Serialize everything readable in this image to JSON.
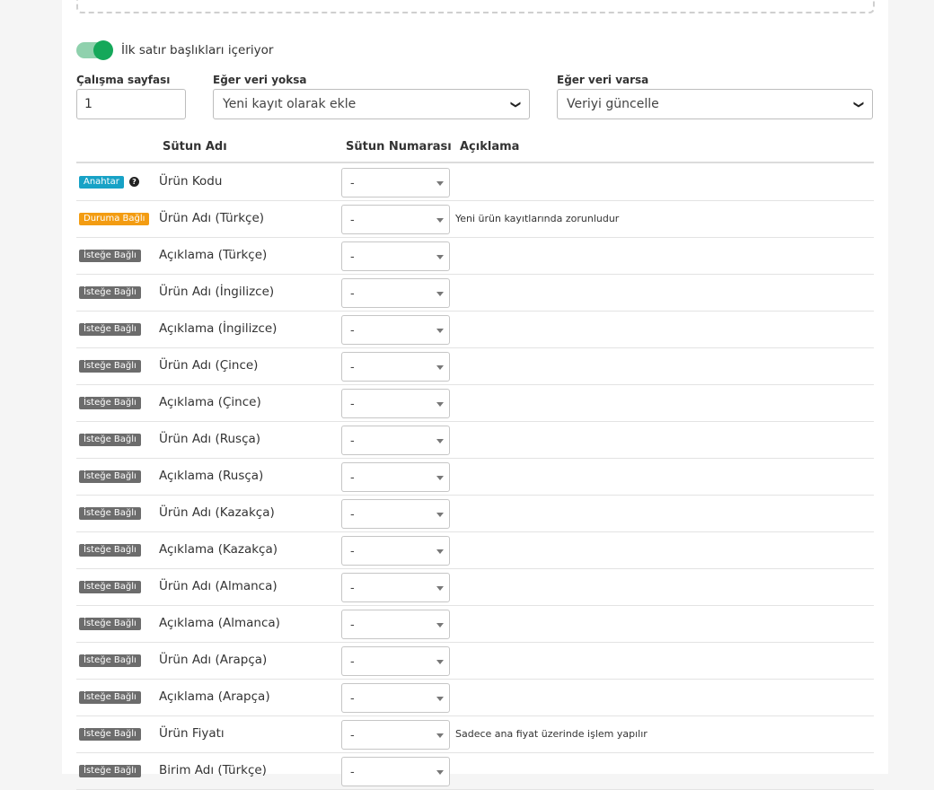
{
  "toggle": {
    "label": "İlk satır başlıkları içeriyor",
    "on": true
  },
  "fields": {
    "sheet_label": "Çalışma sayfası",
    "sheet_value": "1",
    "if_no_data_label": "Eğer veri yoksa",
    "if_no_data_value": "Yeni kayıt olarak ekle",
    "if_data_label": "Eğer veri varsa",
    "if_data_value": "Veriyi güncelle"
  },
  "table": {
    "headers": {
      "column_name": "Sütun Adı",
      "column_number": "Sütun Numarası",
      "description": "Açıklama"
    },
    "rows": [
      {
        "badge": "Anahtar",
        "type": "key",
        "help": true,
        "name": "Ürün Kodu",
        "value": "-",
        "desc": ""
      },
      {
        "badge": "Duruma Bağlı",
        "type": "cond",
        "name": "Ürün Adı (Türkçe)",
        "value": "-",
        "desc": "Yeni ürün kayıtlarında zorunludur"
      },
      {
        "badge": "İsteğe Bağlı",
        "type": "opt",
        "name": "Açıklama (Türkçe)",
        "value": "-",
        "desc": ""
      },
      {
        "badge": "İsteğe Bağlı",
        "type": "opt",
        "name": "Ürün Adı (İngilizce)",
        "value": "-",
        "desc": ""
      },
      {
        "badge": "İsteğe Bağlı",
        "type": "opt",
        "name": "Açıklama (İngilizce)",
        "value": "-",
        "desc": ""
      },
      {
        "badge": "İsteğe Bağlı",
        "type": "opt",
        "name": "Ürün Adı (Çince)",
        "value": "-",
        "desc": ""
      },
      {
        "badge": "İsteğe Bağlı",
        "type": "opt",
        "name": "Açıklama (Çince)",
        "value": "-",
        "desc": ""
      },
      {
        "badge": "İsteğe Bağlı",
        "type": "opt",
        "name": "Ürün Adı (Rusça)",
        "value": "-",
        "desc": ""
      },
      {
        "badge": "İsteğe Bağlı",
        "type": "opt",
        "name": "Açıklama (Rusça)",
        "value": "-",
        "desc": ""
      },
      {
        "badge": "İsteğe Bağlı",
        "type": "opt",
        "name": "Ürün Adı (Kazakça)",
        "value": "-",
        "desc": ""
      },
      {
        "badge": "İsteğe Bağlı",
        "type": "opt",
        "name": "Açıklama (Kazakça)",
        "value": "-",
        "desc": ""
      },
      {
        "badge": "İsteğe Bağlı",
        "type": "opt",
        "name": "Ürün Adı (Almanca)",
        "value": "-",
        "desc": ""
      },
      {
        "badge": "İsteğe Bağlı",
        "type": "opt",
        "name": "Açıklama (Almanca)",
        "value": "-",
        "desc": ""
      },
      {
        "badge": "İsteğe Bağlı",
        "type": "opt",
        "name": "Ürün Adı (Arapça)",
        "value": "-",
        "desc": ""
      },
      {
        "badge": "İsteğe Bağlı",
        "type": "opt",
        "name": "Açıklama (Arapça)",
        "value": "-",
        "desc": ""
      },
      {
        "badge": "İsteğe Bağlı",
        "type": "opt",
        "name": "Ürün Fiyatı",
        "value": "-",
        "desc": "Sadece ana fiyat üzerinde işlem yapılır"
      },
      {
        "badge": "İsteğe Bağlı",
        "type": "opt",
        "name": "Birim Adı (Türkçe)",
        "value": "-",
        "desc": ""
      }
    ]
  },
  "colors": {
    "toggle_on": "#15a85a",
    "key_badge": "#17a2c6",
    "cond_badge": "#f39c12",
    "opt_badge": "#6c6c6c"
  }
}
